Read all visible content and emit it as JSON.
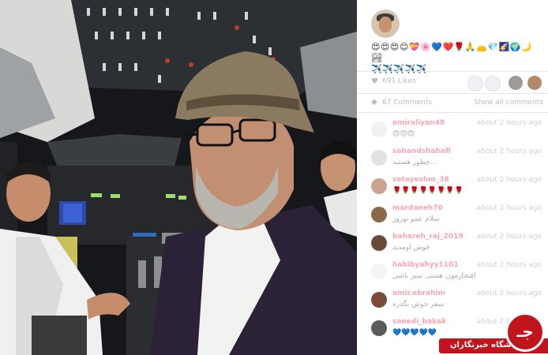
{
  "post": {
    "caption_lines": [
      "😍😍😍😊💝🌸💙❤️🌹🙏👝💎🌠🌍🌙🏞",
      "✈️✈️✈️✈️✈️"
    ],
    "likes_text": "691 Likes",
    "comments_text": "67 Comments",
    "show_all_label": "Show all comments"
  },
  "comments": [
    {
      "user": "amiraliyan48",
      "text": "😍😍😍",
      "time": "about 2 hours ago",
      "avatar_color": "#f1f1f1"
    },
    {
      "user": "sahandshahafi",
      "text": "چطور هستید...",
      "time": "about 2 hours ago",
      "avatar_color": "#e2e2e2"
    },
    {
      "user": "setayeshm_38",
      "text": "🌹🌹🌹🌹🌹🌹🌹🌹",
      "time": "about 2 hours ago",
      "avatar_color": "#c9a58d"
    },
    {
      "user": "mardaneh70",
      "text": "سلام عمو نوروز",
      "time": "about 2 hours ago",
      "avatar_color": "#8a6a4a"
    },
    {
      "user": "bahareh_raj_2019",
      "text": "خوش اومدید",
      "time": "about 2 hours ago",
      "avatar_color": "#6a4a3a"
    },
    {
      "user": "habibyahyy1101",
      "text": "افتخارمون هستی سبز باشی",
      "time": "about 2 hours ago",
      "avatar_color": "#f4f4f4"
    },
    {
      "user": "amir.ebrahim",
      "text": "سفر خوش بگذره",
      "time": "about 2 hours ago",
      "avatar_color": "#7a4a3a"
    },
    {
      "user": "saeedi_bakak",
      "text": "💙💙💙💙💙",
      "time": "about 2 hours ago",
      "avatar_color": "#5a5a5a"
    }
  ],
  "badge": {
    "text": "باشگاه خبرنگاران",
    "glyph": "جـ"
  },
  "colors": {
    "badge_red": "#c0151d",
    "username_pink": "#f7a6b2"
  }
}
